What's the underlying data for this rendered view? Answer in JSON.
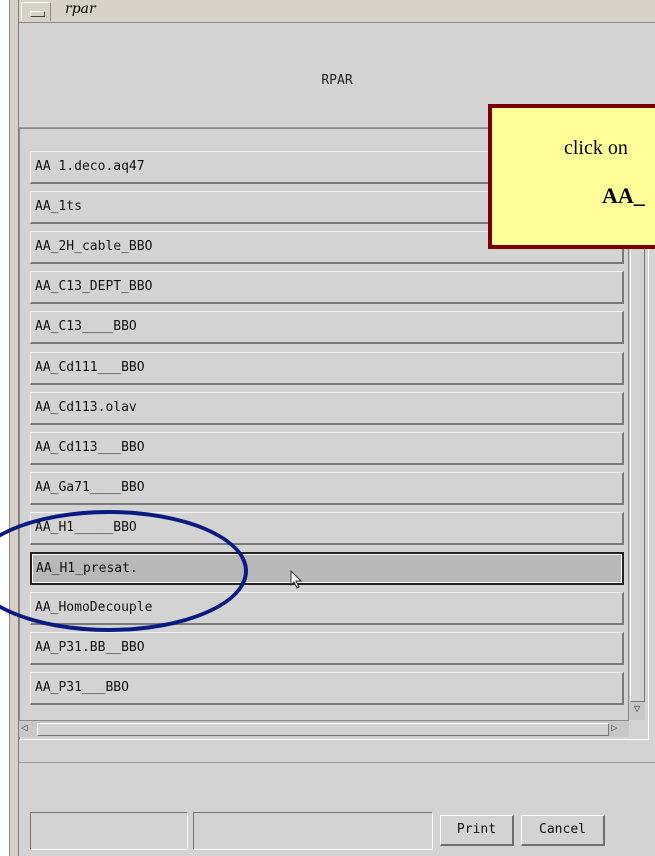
{
  "window": {
    "title": "rpar"
  },
  "header": {
    "title": "RPAR"
  },
  "list": {
    "items": [
      "AA 1.deco.aq47",
      "AA_1ts",
      "AA_2H_cable_BBO",
      "AA_C13_DEPT_BBO",
      "AA_C13____BBO",
      "AA_Cd111___BBO",
      "AA_Cd113.olav",
      "AA_Cd113___BBO",
      "AA_Ga71____BBO",
      "AA_H1_____BBO",
      "AA_H1_presat.",
      "AA_HomoDecouple",
      "AA_P31.BB__BBO",
      "AA_P31___BBO"
    ],
    "selected_index": 10
  },
  "footer": {
    "print_label": "Print",
    "cancel_label": "Cancel"
  },
  "callout": {
    "line1": "click on",
    "line2": "AA_"
  },
  "icons": {
    "window_menu": "window-menu-icon",
    "cursor": "mouse-pointer-icon",
    "scroll_left": "arrow-left-icon",
    "scroll_right": "arrow-right-icon",
    "scroll_down": "arrow-down-icon"
  },
  "colors": {
    "callout_bg": "#ffff99",
    "callout_border": "#7a0000",
    "annotation_ellipse": "#0a1a82"
  }
}
